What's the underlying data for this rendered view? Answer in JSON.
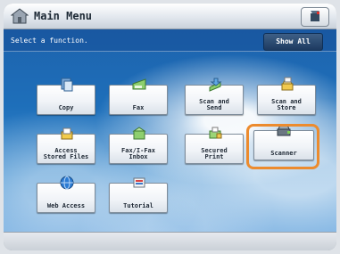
{
  "header": {
    "title": "Main Menu"
  },
  "subheader": {
    "instruction": "Select a function.",
    "show_all_label": "Show All"
  },
  "functions": [
    {
      "label": "Copy",
      "icon": "copy-icon"
    },
    {
      "label": "Fax",
      "icon": "fax-icon"
    },
    {
      "label": "Scan and\nSend",
      "icon": "scan-send-icon"
    },
    {
      "label": "Scan and\nStore",
      "icon": "scan-store-icon"
    },
    {
      "label": "Access\nStored Files",
      "icon": "stored-files-icon"
    },
    {
      "label": "Fax/I-Fax\nInbox",
      "icon": "fax-inbox-icon"
    },
    {
      "label": "Secured\nPrint",
      "icon": "secured-print-icon"
    },
    {
      "label": "Scanner",
      "icon": "scanner-icon"
    },
    {
      "label": "Web Access",
      "icon": "web-access-icon"
    },
    {
      "label": "Tutorial",
      "icon": "tutorial-icon"
    }
  ],
  "colors": {
    "highlight": "#ec8b2e",
    "sky": "#1e6fba"
  }
}
